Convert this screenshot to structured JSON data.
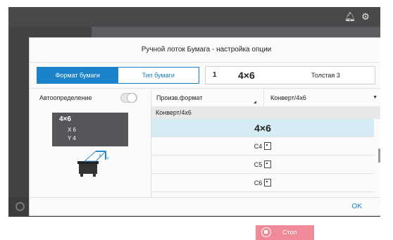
{
  "dialog": {
    "title": "Ручной лоток Бумага - настройка опции",
    "tabs": [
      {
        "label": "Формат бумаги",
        "active": true
      },
      {
        "label": "Тип бумаги",
        "active": false
      }
    ],
    "summary": {
      "tray_number": "1",
      "size": "4×6",
      "paper": "Толстая 3"
    },
    "auto_detect": {
      "label": "Автоопределение",
      "enabled": false
    },
    "select_format": {
      "value": "Произв.формат"
    },
    "select_envelope": {
      "value": "Конверт/4x6"
    },
    "preview": {
      "title": "4×6",
      "x": "X  6",
      "y": "Y  4"
    },
    "list": {
      "header": "Конверт/4x6",
      "items": [
        {
          "label": "4×6",
          "selected": true,
          "icon": null
        },
        {
          "label": "C4",
          "selected": false,
          "icon": "envelope-icon"
        },
        {
          "label": "C5",
          "selected": false,
          "icon": "envelope-icon"
        },
        {
          "label": "C6",
          "selected": false,
          "icon": "envelope-icon"
        }
      ]
    },
    "ok_label": "OK"
  },
  "stop_button": {
    "label": "Стоп",
    "color": "#ef8a99"
  },
  "colors": {
    "accent": "#1a82c8",
    "selected_row": "#d6ecf5"
  }
}
